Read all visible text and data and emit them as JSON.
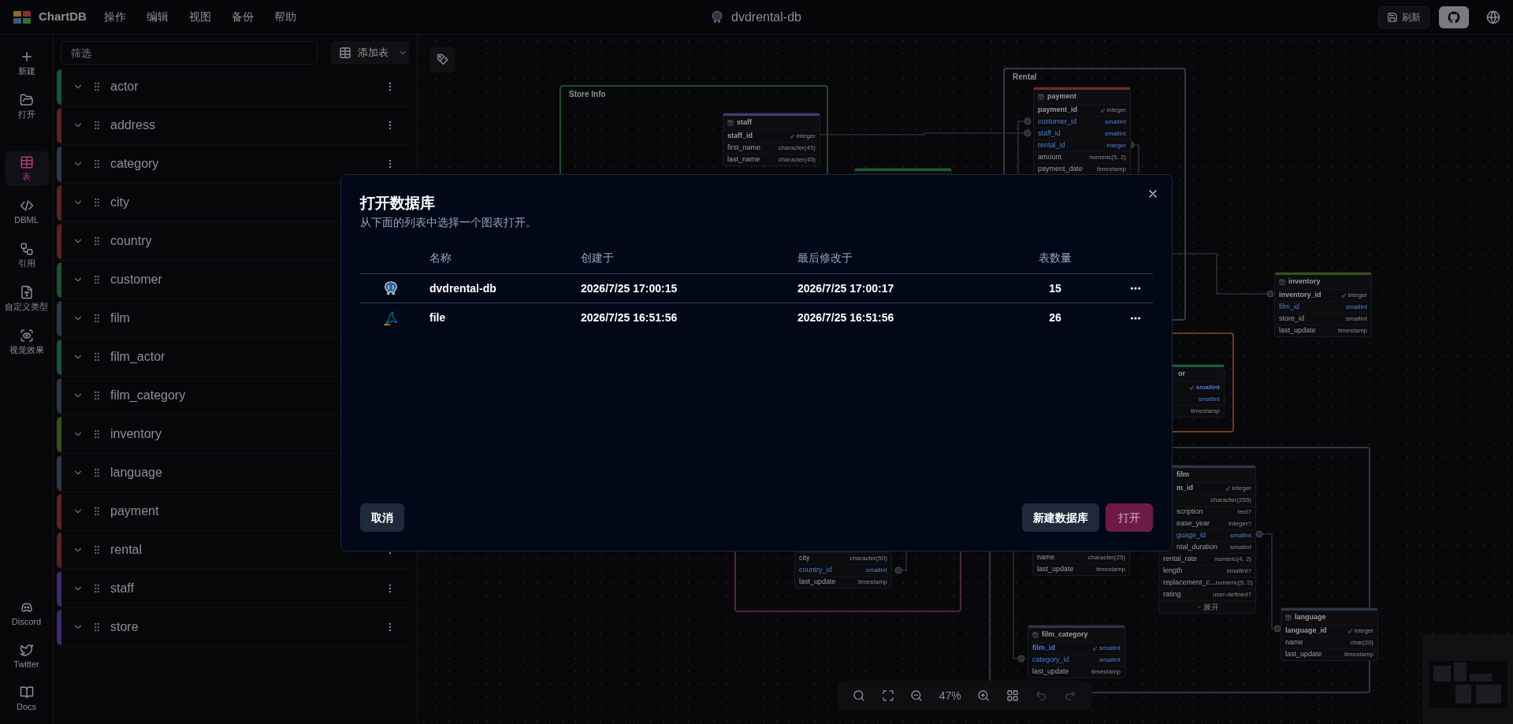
{
  "top_bar": {
    "logo": "ChartDB",
    "menus": [
      "操作",
      "编辑",
      "视图",
      "备份",
      "帮助"
    ],
    "diagram_name": "dvdrental-db",
    "save_button": "刷新"
  },
  "sidebar": {
    "items": [
      {
        "label": "新建",
        "selected": false
      },
      {
        "label": "打开",
        "selected": false
      },
      {
        "label": "表",
        "selected": true
      },
      {
        "label": "DBML",
        "selected": false
      },
      {
        "label": "引用",
        "selected": false
      },
      {
        "label": "自定义类型",
        "selected": false
      },
      {
        "label": "视觉效果",
        "selected": false
      }
    ],
    "bottom_items": [
      "Discord",
      "Twitter",
      "Docs"
    ]
  },
  "tables_panel": {
    "filter_placeholder": "筛选",
    "add_table_button": "添加表",
    "tables": [
      {
        "name": "actor",
        "color": "#13573d"
      },
      {
        "name": "address",
        "color": "#5e2222"
      },
      {
        "name": "category",
        "color": "#2c3747"
      },
      {
        "name": "city",
        "color": "#5e2222"
      },
      {
        "name": "country",
        "color": "#5e2222"
      },
      {
        "name": "customer",
        "color": "#1c5230"
      },
      {
        "name": "film",
        "color": "#2c3747"
      },
      {
        "name": "film_actor",
        "color": "#13573d"
      },
      {
        "name": "film_category",
        "color": "#2c3747"
      },
      {
        "name": "inventory",
        "color": "#36501a"
      },
      {
        "name": "language",
        "color": "#2c3747"
      },
      {
        "name": "payment",
        "color": "#5e2222"
      },
      {
        "name": "rental",
        "color": "#5e2222"
      },
      {
        "name": "staff",
        "color": "#3e2870"
      },
      {
        "name": "store",
        "color": "#3e2870"
      }
    ]
  },
  "canvas": {
    "areas": [
      {
        "title": "Store Info",
        "color": "#1d4a2d"
      },
      {
        "title": "Rental",
        "color": "#3e3548"
      },
      {
        "color": "#6e3c1c"
      },
      {
        "color": "#2c3645"
      },
      {
        "color": "#52233f"
      }
    ],
    "tables": [
      {
        "name": "staff",
        "color": "#4a3878",
        "rows": [
          {
            "name": "staff_id",
            "type": "integer",
            "key": true,
            "link": false
          },
          {
            "name": "first_name",
            "type": "character(45)",
            "key": false,
            "link": false
          },
          {
            "name": "last_name",
            "type": "character(45)",
            "key": false,
            "link": false
          }
        ]
      },
      {
        "color": "#175f34"
      },
      {
        "name": "payment",
        "color": "#722a26",
        "rows": [
          {
            "name": "payment_id",
            "type": "integer",
            "key": true,
            "link": false
          },
          {
            "name": "customer_id",
            "type": "smallint",
            "key": false,
            "link": true
          },
          {
            "name": "staff_id",
            "type": "smallint",
            "key": false,
            "link": true
          },
          {
            "name": "rental_id",
            "type": "integer",
            "key": false,
            "link": true
          },
          {
            "name": "amount",
            "type": "numeric(5, 2)",
            "key": false,
            "link": false
          },
          {
            "name": "payment_date",
            "type": "timestamp",
            "key": false,
            "link": false
          }
        ]
      },
      {
        "name": "inventory",
        "color": "#36501a",
        "rows": [
          {
            "name": "inventory_id",
            "type": "integer",
            "key": true,
            "link": false
          },
          {
            "name": "film_id",
            "type": "smallint",
            "key": false,
            "link": true
          },
          {
            "name": "store_id",
            "type": "smallint",
            "key": false,
            "link": false
          },
          {
            "name": "last_update",
            "type": "timestamp",
            "key": false,
            "link": false
          }
        ]
      },
      {
        "name": "or",
        "color": "#175f34",
        "rows": [
          {
            "type": "smallint",
            "key": true,
            "link": true
          },
          {
            "type": "smallint",
            "key": false,
            "link": true
          },
          {
            "type": "timestamp",
            "key": false,
            "link": false
          }
        ]
      },
      {
        "name": "film",
        "color": "#2c3747",
        "expand_button": "展开",
        "rows": [
          {
            "name": "m_id",
            "type": "integer",
            "key": true,
            "link": false
          },
          {
            "type": "character(255)",
            "key": false,
            "link": false
          },
          {
            "name": "scription",
            "type": "text?",
            "key": false,
            "link": false
          },
          {
            "name": "ease_year",
            "type": "integer?",
            "key": false,
            "link": false
          },
          {
            "name": "guage_id",
            "type": "smallint",
            "key": false,
            "link": true
          },
          {
            "name": "ntal_duration",
            "type": "smallint",
            "key": false,
            "link": false
          },
          {
            "name": "rental_rate",
            "type": "numeric(4, 2)",
            "key": false,
            "link": false
          },
          {
            "name": "length",
            "type": "smallint?",
            "key": false,
            "link": false
          },
          {
            "name": "replacement_c...",
            "type": "numeric(5, 2)",
            "key": false,
            "link": false
          },
          {
            "name": "rating",
            "type": "user-defined?",
            "key": false,
            "link": false
          }
        ]
      },
      {
        "rows": [
          {
            "name": "city",
            "type": "character(50)",
            "key": false,
            "link": false
          },
          {
            "name": "country_id",
            "type": "smallint",
            "key": false,
            "link": true
          },
          {
            "name": "last_update",
            "type": "timestamp",
            "key": false,
            "link": false
          }
        ]
      },
      {
        "rows": [
          {
            "name": "name",
            "type": "character(25)",
            "key": false,
            "link": false
          },
          {
            "name": "last_update",
            "type": "timestamp",
            "key": false,
            "link": false
          }
        ]
      },
      {
        "name": "film_category",
        "color": "#2c3747",
        "rows": [
          {
            "name": "film_id",
            "type": "smallint",
            "key": true,
            "link": true
          },
          {
            "name": "category_id",
            "type": "smallint",
            "key": false,
            "link": true
          },
          {
            "name": "last_update",
            "type": "timestamp",
            "key": false,
            "link": false
          }
        ]
      },
      {
        "name": "language",
        "color": "#2c3747",
        "rows": [
          {
            "name": "language_id",
            "type": "integer",
            "key": true,
            "link": false
          },
          {
            "name": "name",
            "type": "char(20)",
            "key": false,
            "link": false
          },
          {
            "name": "last_update",
            "type": "timestamp",
            "key": false,
            "link": false
          }
        ]
      }
    ],
    "zoom_level": "47%"
  },
  "dialog": {
    "title": "打开数据库",
    "description": "从下面的列表中选择一个图表打开。",
    "columns": [
      "名称",
      "创建于",
      "最后修改于",
      "表数量"
    ],
    "rows": [
      {
        "kind": "postgres",
        "name": "dvdrental-db",
        "created": "2026/7/25 17:00:15",
        "modified": "2026/7/25 17:00:17",
        "table_count": "15"
      },
      {
        "kind": "mysql",
        "name": "file",
        "created": "2026/7/25 16:51:56",
        "modified": "2026/7/25 16:51:56",
        "table_count": "26"
      }
    ],
    "cancel_button": "取消",
    "create_button": "新建数据库",
    "open_button": "打开",
    "open_disabled": true
  }
}
